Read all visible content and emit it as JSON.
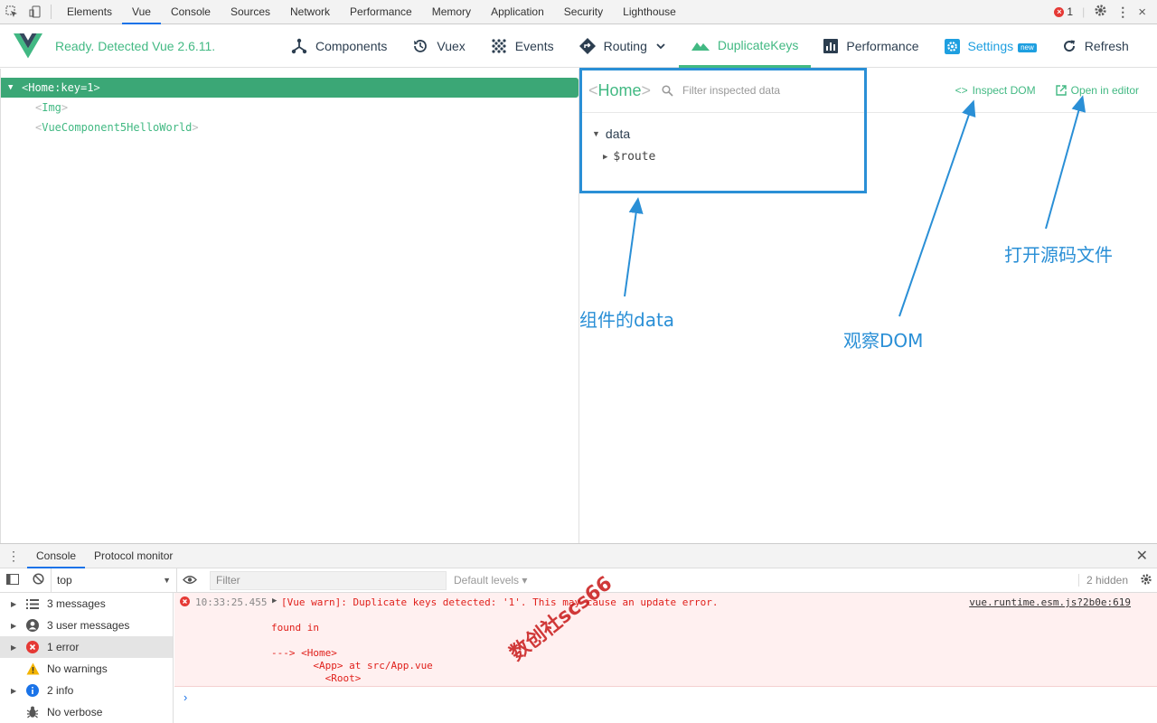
{
  "devtools": {
    "tabs": [
      "Elements",
      "Vue",
      "Console",
      "Sources",
      "Network",
      "Performance",
      "Memory",
      "Application",
      "Security",
      "Lighthouse"
    ],
    "active_tab": "Vue",
    "error_count": "1"
  },
  "vue": {
    "status": "Ready. Detected Vue 2.6.11.",
    "nav": {
      "components": "Components",
      "vuex": "Vuex",
      "events": "Events",
      "routing": "Routing",
      "duplicate_keys": "DuplicateKeys",
      "performance": "Performance",
      "settings": "Settings",
      "new_badge": "new",
      "refresh": "Refresh"
    },
    "accent_color": "#42b983"
  },
  "tree": {
    "root": {
      "open": "<",
      "name": "Home:key=1",
      "close": ">"
    },
    "children": [
      {
        "name": "Img"
      },
      {
        "name": "VueComponent5HelloWorld"
      }
    ]
  },
  "inspector": {
    "title": "Home",
    "filter_placeholder": "Filter inspected data",
    "inspect_dom": "Inspect DOM",
    "open_in_editor": "Open in editor",
    "section": "data",
    "item": "$route"
  },
  "annotations": {
    "component_data": "组件的data",
    "observe_dom": "观察DOM",
    "open_source": "打开源码文件",
    "color": "#2a8fd6"
  },
  "drawer": {
    "tabs": [
      "Console",
      "Protocol monitor"
    ]
  },
  "console_toolbar": {
    "context": "top",
    "filter_placeholder": "Filter",
    "levels": "Default levels ▾",
    "hidden": "2 hidden"
  },
  "console_sidebar": [
    {
      "label": "3 messages",
      "icon": "list-icon"
    },
    {
      "label": "3 user messages",
      "icon": "user-icon"
    },
    {
      "label": "1 error",
      "icon": "error-icon"
    },
    {
      "label": "No warnings",
      "icon": "warning-icon"
    },
    {
      "label": "2 info",
      "icon": "info-icon"
    },
    {
      "label": "No verbose",
      "icon": "bug-icon"
    }
  ],
  "console_message": {
    "time": "10:33:25.455",
    "text": "[Vue warn]: Duplicate keys detected: '1'. This may cause an update error.",
    "found": "found in",
    "trace1": "---> <Home>",
    "trace2": "       <App> at src/App.vue",
    "trace3": "         <Root>",
    "source": "vue.runtime.esm.js?2b0e:619"
  },
  "watermark": "数创社scs66"
}
